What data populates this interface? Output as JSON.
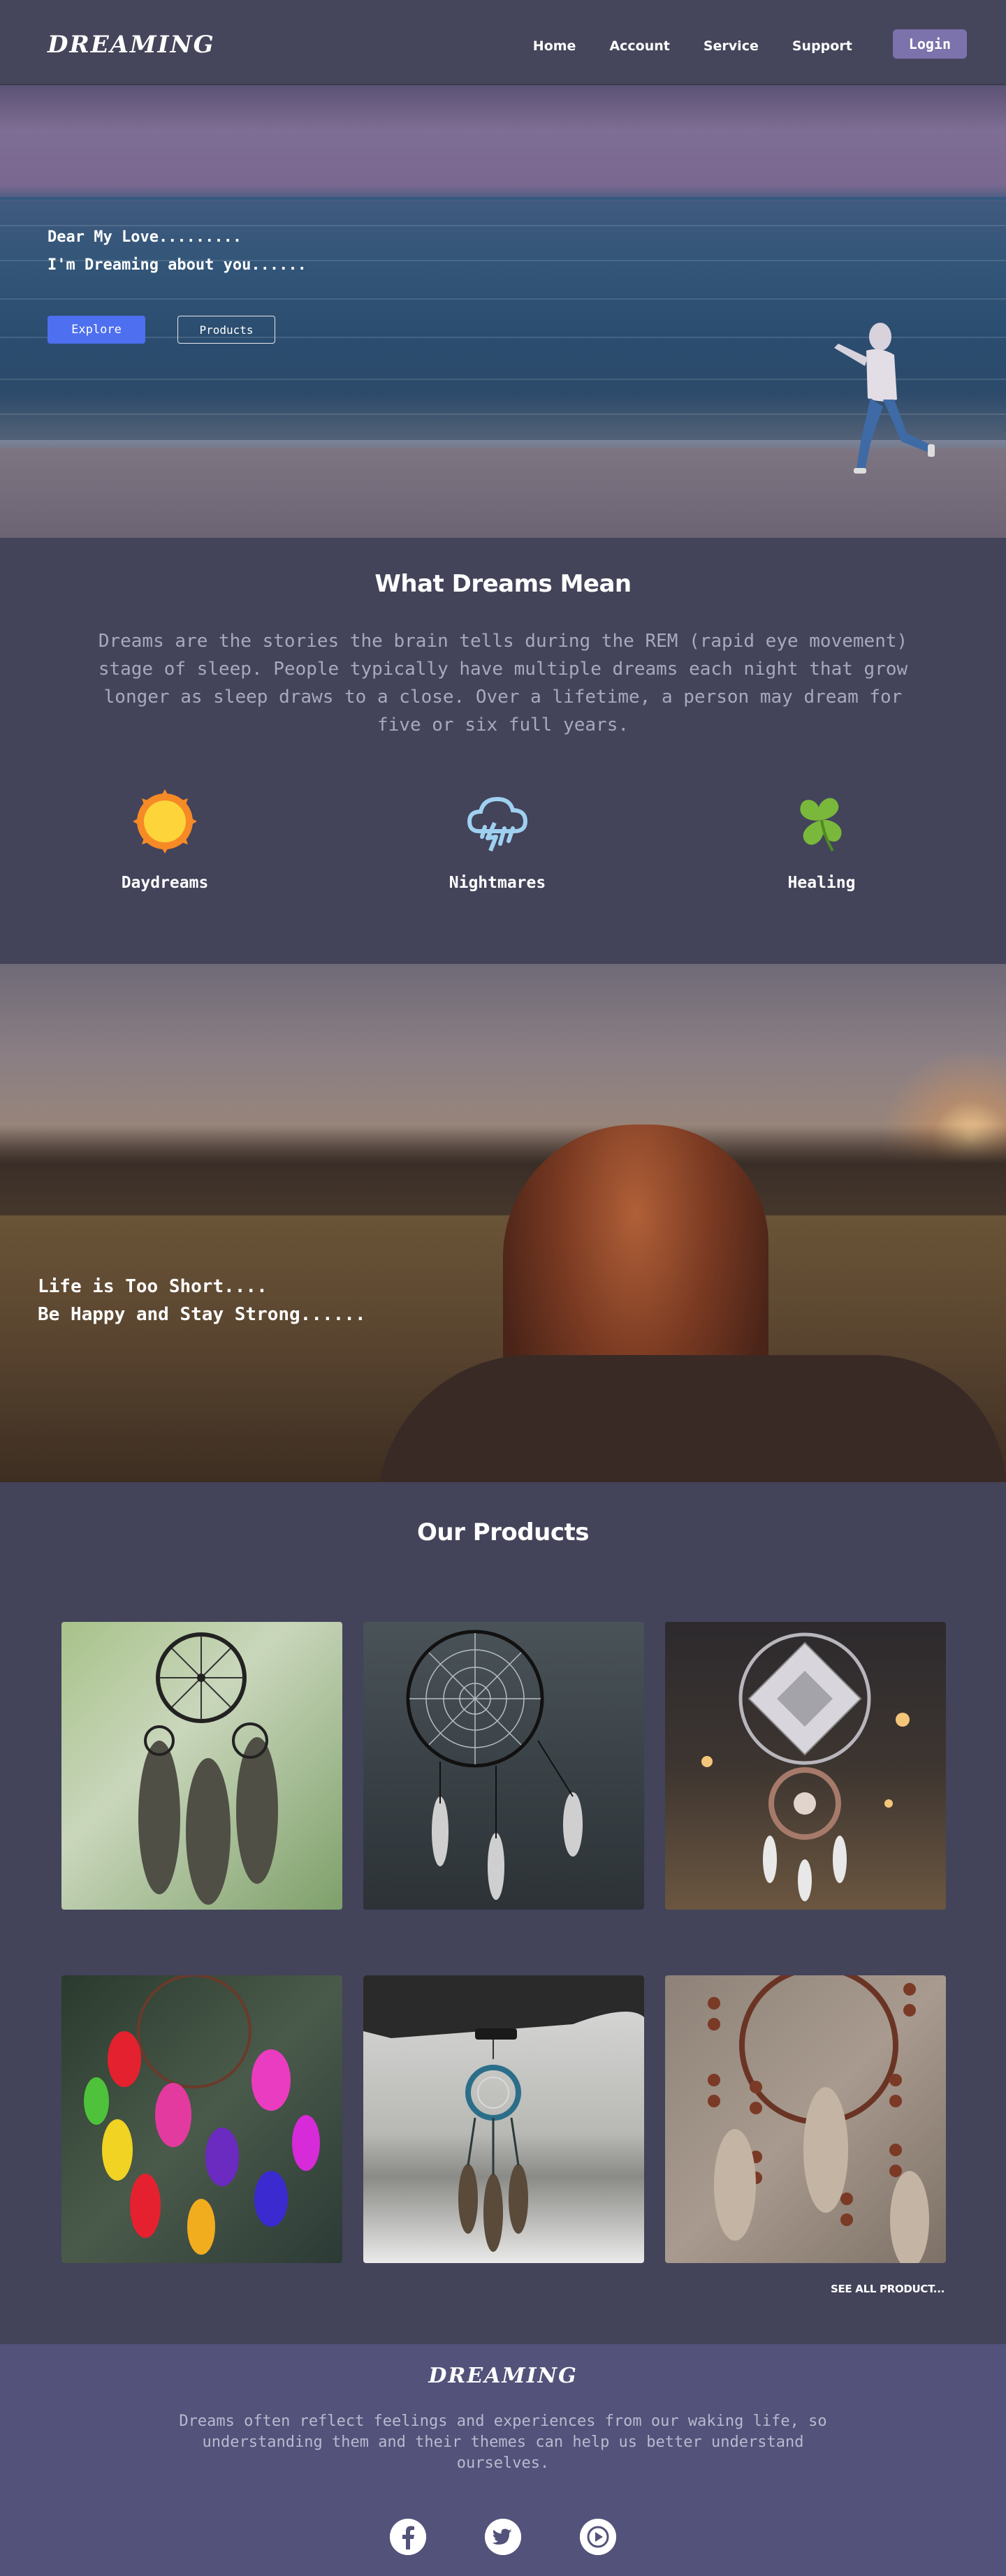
{
  "nav": {
    "brand": "DREAMING",
    "links": [
      "Home",
      "Account",
      "Service",
      "Support"
    ],
    "login_label": "Login"
  },
  "hero": {
    "line1": "Dear My Love.........",
    "line2": "I'm Dreaming about you......",
    "explore_label": "Explore",
    "products_label": "Products"
  },
  "dreams": {
    "title": "What Dreams Mean",
    "description": "Dreams are the stories the brain tells during the REM (rapid eye movement) stage of sleep. People typically have multiple dreams each night that grow longer as sleep draws to a close. Over a lifetime, a person may dream for five or six full years.",
    "features": [
      {
        "label": "Daydreams",
        "icon": "sun-icon"
      },
      {
        "label": "Nightmares",
        "icon": "storm-cloud-icon"
      },
      {
        "label": "Healing",
        "icon": "four-leaf-clover-icon"
      }
    ]
  },
  "banner": {
    "line1": "Life is Too Short....",
    "line2": "Be Happy and Stay Strong......"
  },
  "products": {
    "title": "Our Products",
    "see_all": "SEE ALL PRODUCT..."
  },
  "footer": {
    "brand": "DREAMING",
    "text": "Dreams often reflect feelings and experiences from our waking life, so understanding them and their themes can help us better understand ourselves.",
    "socials": [
      "facebook-icon",
      "twitter-icon",
      "play-icon"
    ]
  },
  "colors": {
    "page_bg": "#43435a",
    "accent": "#4e6fef",
    "login_bg": "#7c72ac",
    "footer_bg": "#52527a",
    "muted_text": "#a9a9bd"
  }
}
